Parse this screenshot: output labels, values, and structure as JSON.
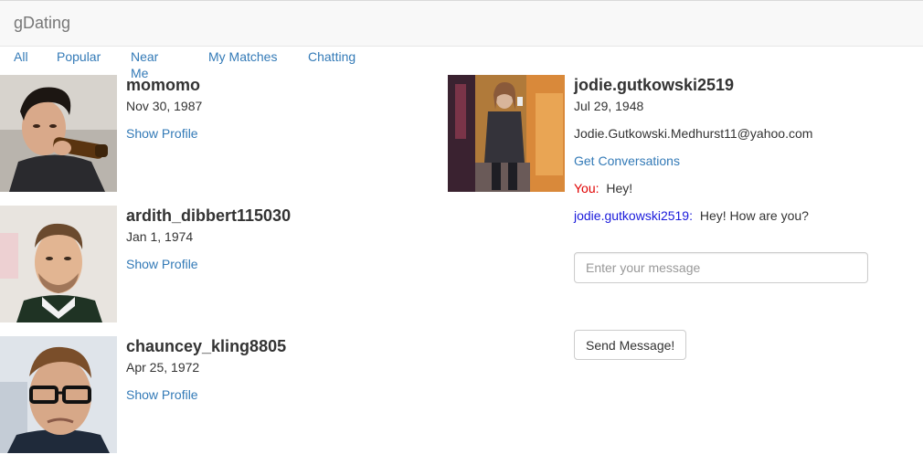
{
  "app": {
    "brand": "gDating"
  },
  "tabs": [
    {
      "label": "All"
    },
    {
      "label": "Popular"
    },
    {
      "label": "Near Me"
    },
    {
      "label": "My Matches"
    },
    {
      "label": "Chatting"
    }
  ],
  "users": [
    {
      "username": "momomo",
      "birthdate": "Nov 30, 1987",
      "action": "Show Profile"
    },
    {
      "username": "ardith_dibbert115030",
      "birthdate": "Jan 1, 1974",
      "action": "Show Profile"
    },
    {
      "username": "chauncey_kling8805",
      "birthdate": "Apr 25, 1972",
      "action": "Show Profile"
    }
  ],
  "selected": {
    "username": "jodie.gutkowski2519",
    "birthdate": "Jul 29, 1948",
    "email": "Jodie.Gutkowski.Medhurst11@yahoo.com",
    "action": "Get Conversations"
  },
  "conversation": [
    {
      "sender": "You:",
      "text": "Hey!"
    },
    {
      "sender": "jodie.gutkowski2519:",
      "text": "Hey! How are you?"
    }
  ],
  "composer": {
    "placeholder": "Enter your message",
    "send_label": "Send Message!"
  },
  "colors": {
    "link": "#337ab7",
    "you_label": "#e00000",
    "them_label": "#1a1adb",
    "navbar_bg": "#f8f8f8"
  }
}
